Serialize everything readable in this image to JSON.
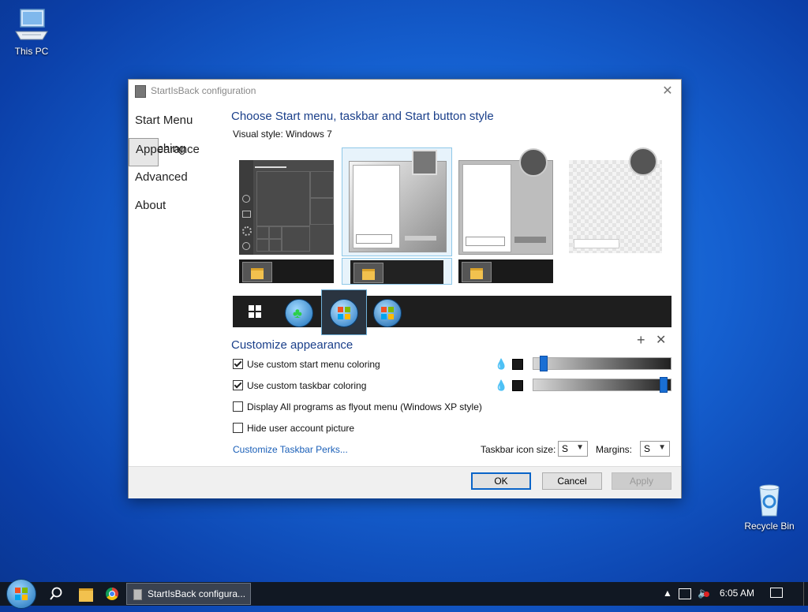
{
  "desktop": {
    "this_pc_label": "This PC",
    "recycle_bin_label": "Recycle Bin"
  },
  "window": {
    "title": "StartIsBack configuration",
    "nav": [
      {
        "label": "Start Menu",
        "selected": false
      },
      {
        "label": "Appearance",
        "selected": true
      },
      {
        "label": "Switching",
        "selected": false
      },
      {
        "label": "Advanced",
        "selected": false
      },
      {
        "label": "About",
        "selected": false
      }
    ],
    "heading": "Choose Start menu, taskbar and Start button style",
    "visual_style_label": "Visual style:",
    "visual_style_value": "Windows 7",
    "customize_heading": "Customize appearance",
    "options": [
      {
        "label": "Use custom start menu coloring",
        "checked": true
      },
      {
        "label": "Use custom taskbar coloring",
        "checked": true
      },
      {
        "label": "Display All programs as flyout menu (Windows XP style)",
        "checked": false
      },
      {
        "label": "Hide user account picture",
        "checked": false
      }
    ],
    "start_menu_slider_level": 0.05,
    "taskbar_slider_level": 0.95,
    "perks_link": "Customize Taskbar Perks...",
    "icon_size_label": "Taskbar icon size:",
    "icon_size_value": "S",
    "margins_label": "Margins:",
    "margins_value": "S",
    "ok_label": "OK",
    "cancel_label": "Cancel",
    "apply_label": "Apply"
  },
  "taskbar": {
    "task_label": "StartIsBack configura...",
    "clock": "6:05 AM"
  },
  "colors": {
    "accent": "#1a6fd4",
    "heading": "#1a3f8a",
    "link": "#1a5fb8"
  }
}
